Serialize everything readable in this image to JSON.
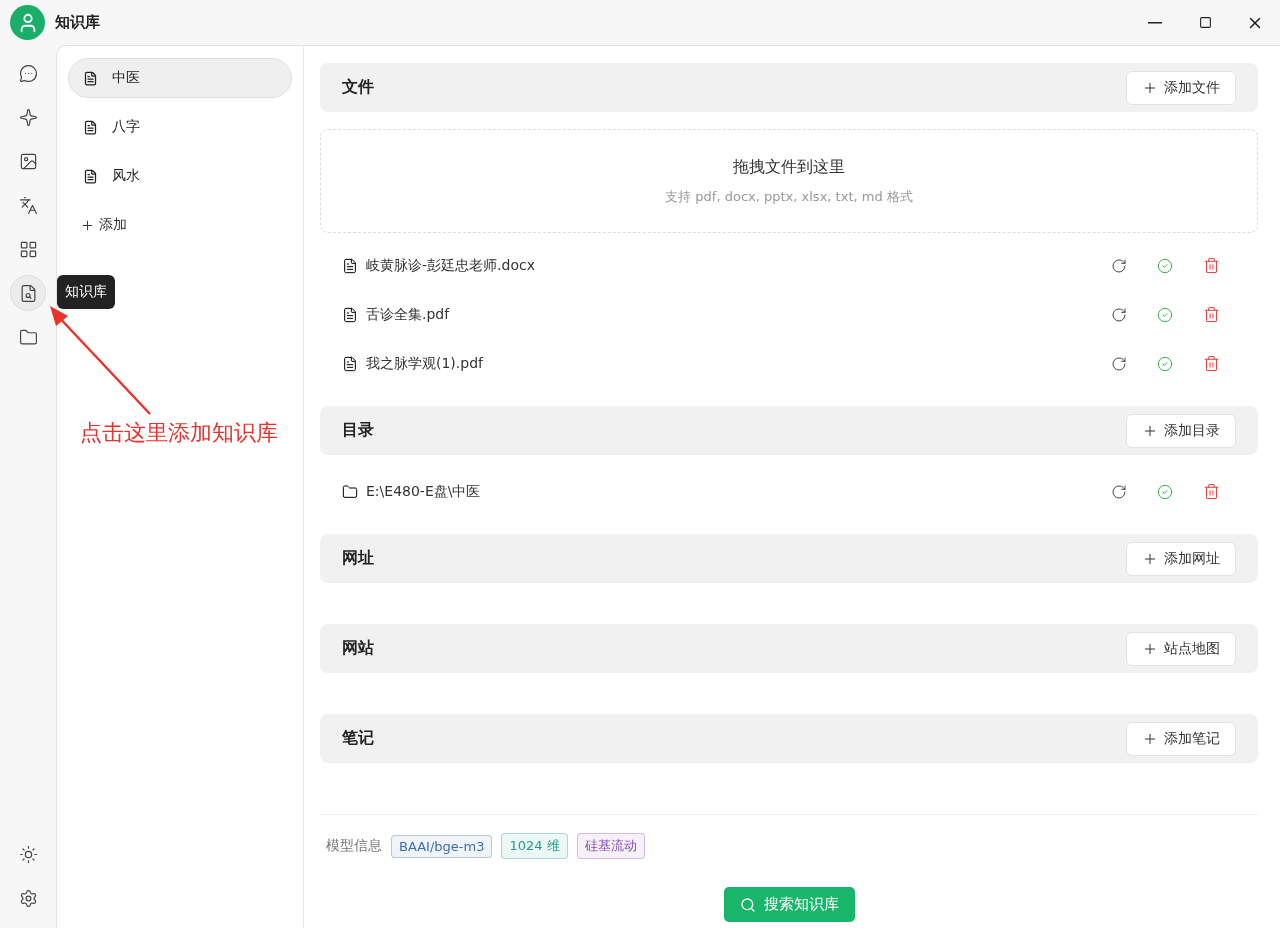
{
  "app": {
    "title": "知识库"
  },
  "rail": {
    "items": [
      {
        "kind": "chat",
        "selected": false
      },
      {
        "kind": "assistant",
        "selected": false
      },
      {
        "kind": "image",
        "selected": false
      },
      {
        "kind": "translate",
        "selected": false
      },
      {
        "kind": "apps",
        "selected": false
      },
      {
        "kind": "knowledge",
        "selected": true
      },
      {
        "kind": "files",
        "selected": false
      }
    ],
    "tooltip": "知识库"
  },
  "bases": {
    "items": [
      {
        "name": "中医",
        "selected": true
      },
      {
        "name": "八字",
        "selected": false
      },
      {
        "name": "风水",
        "selected": false
      }
    ],
    "add_label": "添加"
  },
  "sections": [
    {
      "kind": "files",
      "title": "文件",
      "button": "添加文件",
      "dropzone": {
        "title": "拖拽文件到这里",
        "hint": "支持 pdf, docx, pptx, xlsx, txt, md 格式"
      },
      "items": [
        {
          "name": "岐黄脉诊-彭廷忠老师.docx"
        },
        {
          "name": "舌诊全集.pdf"
        },
        {
          "name": "我之脉学观(1).pdf"
        }
      ]
    },
    {
      "kind": "directories",
      "title": "目录",
      "button": "添加目录",
      "items": [
        {
          "name": "E:\\E480-E盘\\中医"
        }
      ]
    },
    {
      "kind": "urls",
      "title": "网址",
      "button": "添加网址"
    },
    {
      "kind": "sites",
      "title": "网站",
      "button": "站点地图"
    },
    {
      "kind": "notes",
      "title": "笔记",
      "button": "添加笔记"
    }
  ],
  "model_info": {
    "label": "模型信息",
    "tags": [
      {
        "text": "BAAI/bge-m3",
        "color": "#3b6fb0"
      },
      {
        "text": "1024 维",
        "color": "#1f9e8f"
      },
      {
        "text": "硅基流动",
        "color": "#8a4fb5"
      }
    ]
  },
  "search_button": "搜索知识库",
  "annotation": {
    "text": "点击这里添加知识库"
  }
}
